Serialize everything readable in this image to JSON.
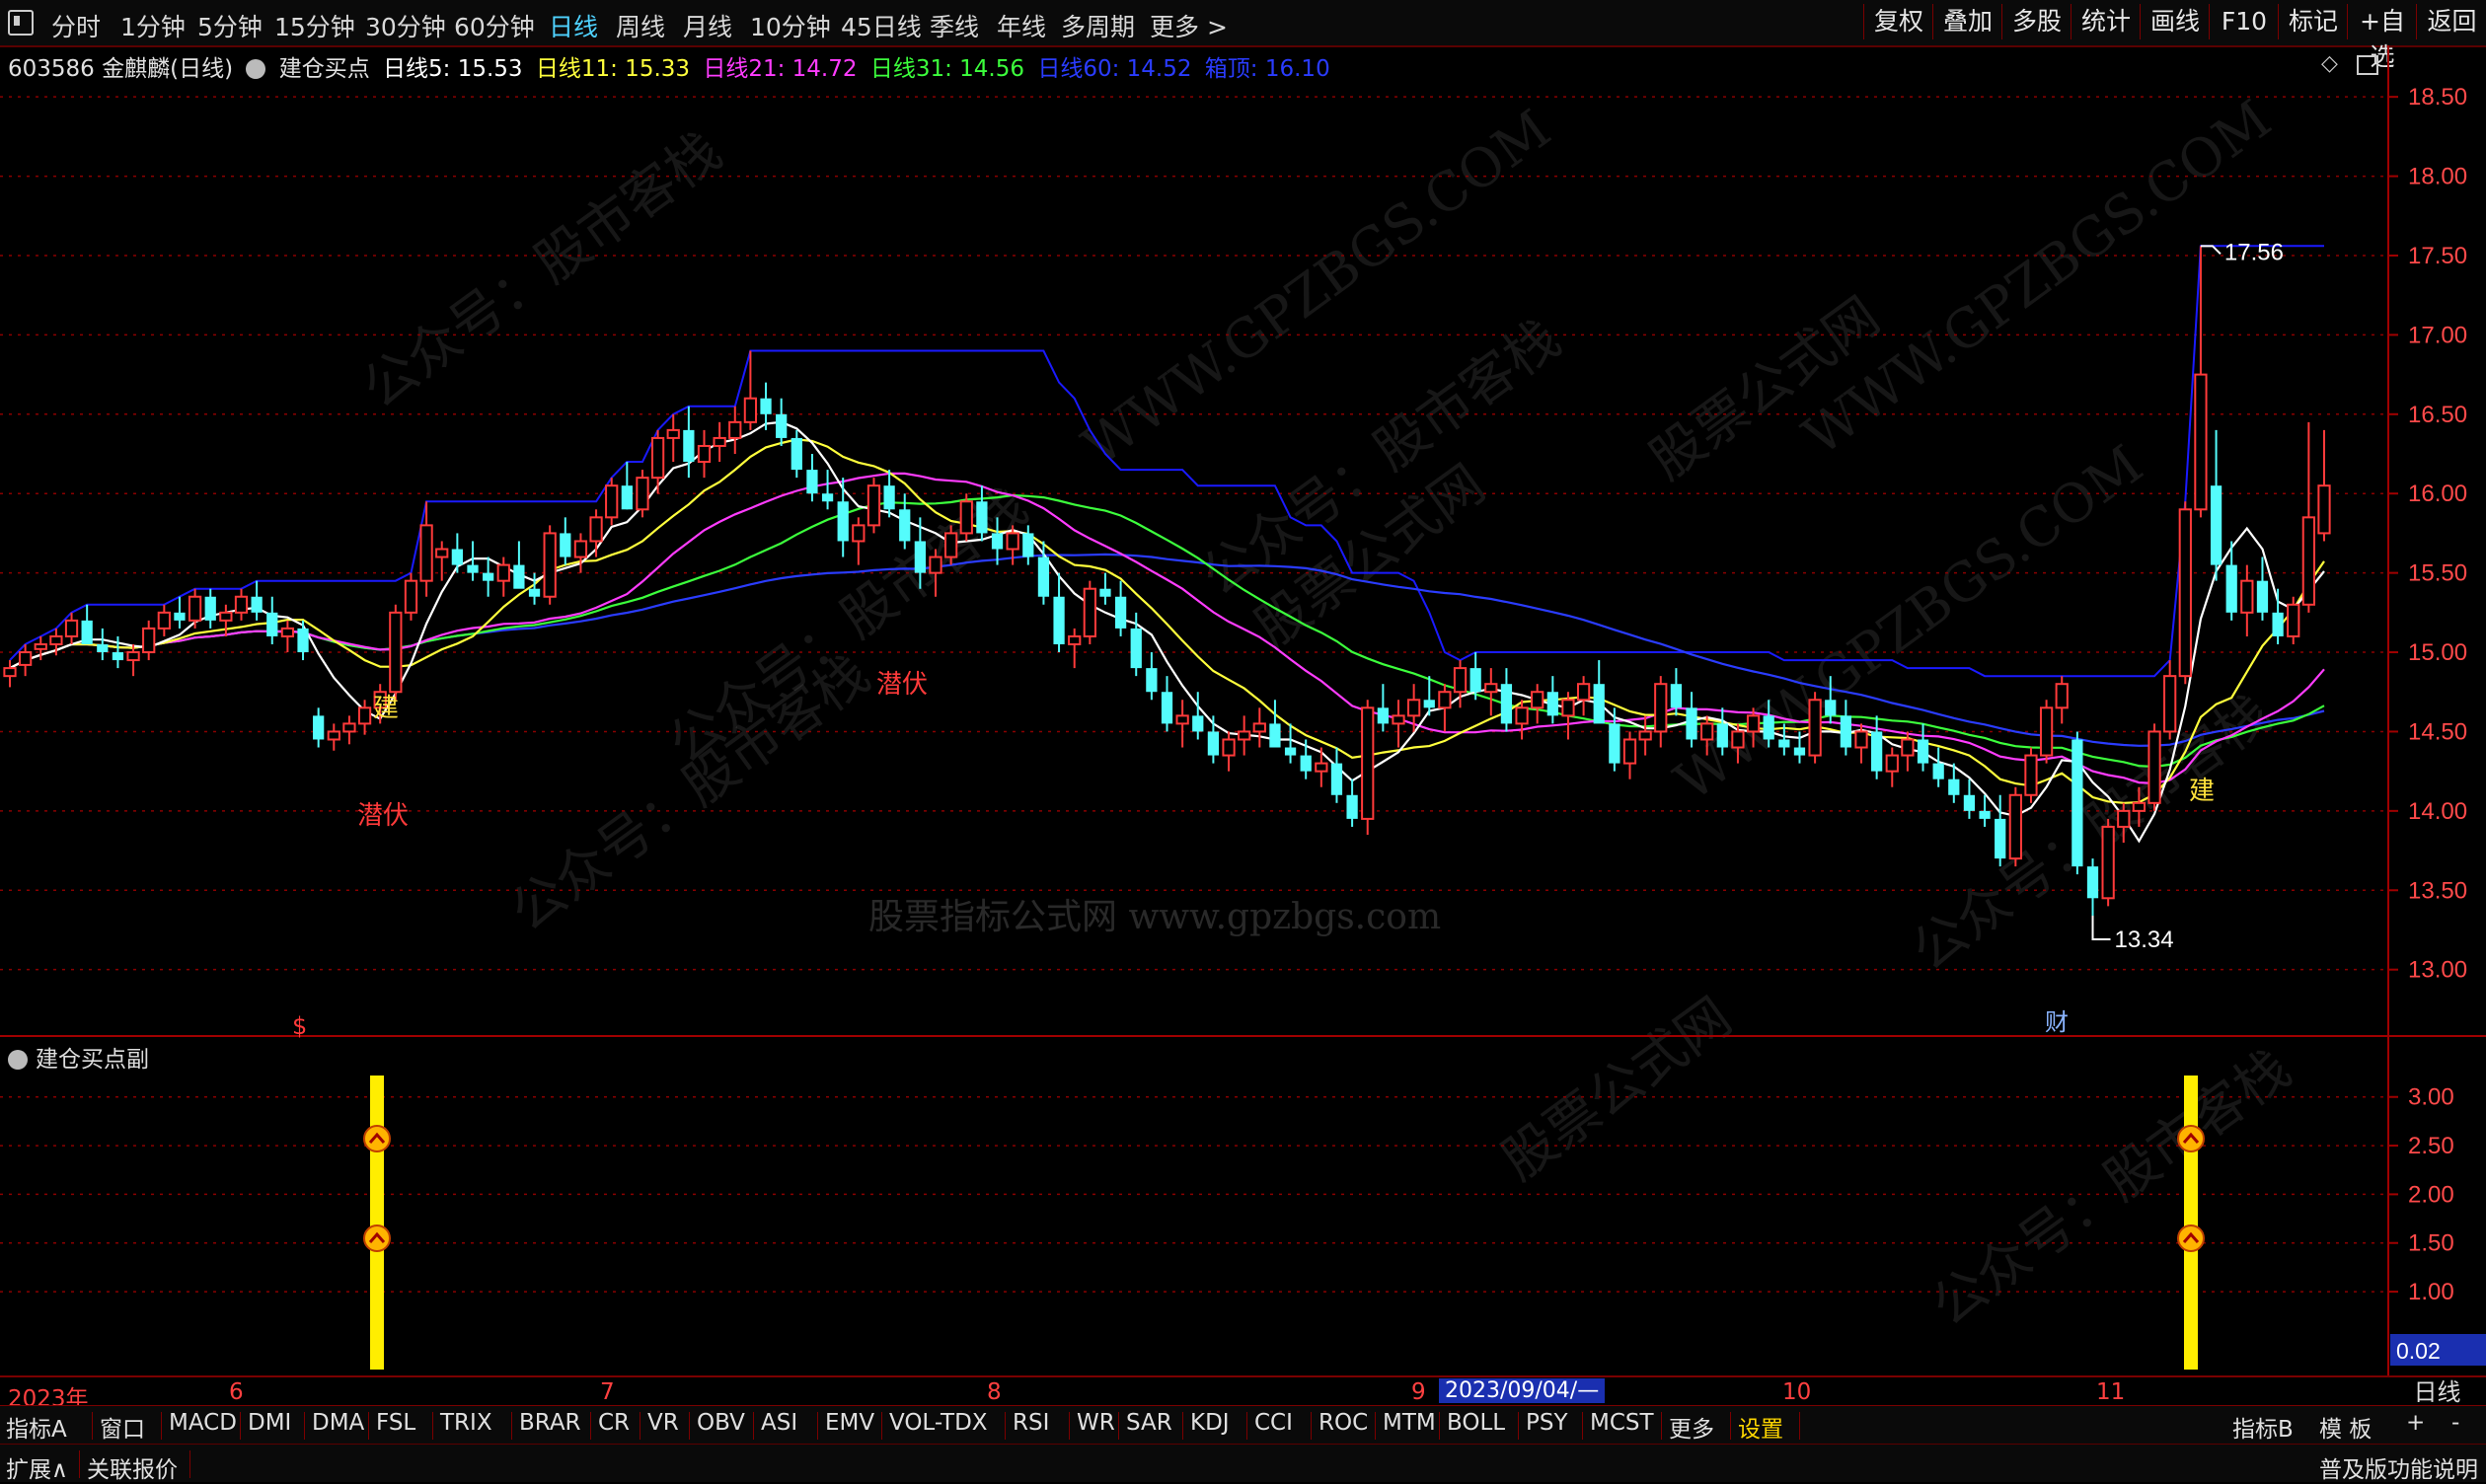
{
  "topbar": {
    "periods": [
      "分时",
      "1分钟",
      "5分钟",
      "15分钟",
      "30分钟",
      "60分钟",
      "日线",
      "周线",
      "月线",
      "10分钟",
      "45日线",
      "季线",
      "年线",
      "多周期",
      "更多 >"
    ],
    "active_period": "日线",
    "right_buttons": [
      "复权",
      "叠加",
      "多股",
      "统计",
      "画线",
      "F10",
      "标记",
      "+自选",
      "返回"
    ]
  },
  "legend": {
    "stock": "603586 金麒麟(日线)",
    "indicator": "建仓买点",
    "ma5": "日线5: 15.53",
    "ma11": "日线11: 15.33",
    "ma21": "日线21: 14.72",
    "ma31": "日线31: 14.56",
    "ma60": "日线60: 14.52",
    "box": "箱顶: 16.10"
  },
  "colors": {
    "up": "#ff3a3a",
    "down": "#54fcfc",
    "ma5": "#ffffff",
    "ma11": "#ffff3c",
    "ma21": "#ff3cff",
    "ma31": "#3cff3c",
    "ma60": "#2a3cff",
    "box": "#1a1aff",
    "grid": "#8a0000"
  },
  "price_axis": [
    "18.50",
    "18.00",
    "17.50",
    "17.00",
    "16.50",
    "16.00",
    "15.50",
    "15.00",
    "14.50",
    "14.00",
    "13.50",
    "13.00"
  ],
  "annotations": {
    "high": "17.56",
    "low": "13.34",
    "build1": "建",
    "build2": "建",
    "hide1": "潜伏",
    "hide2": "潜伏",
    "dollar": "$",
    "cai": "财"
  },
  "watermarks": [
    "公众号：股市客栈",
    "WWW.GPZBGS.COM",
    "股票公式网",
    "股票指标公式网 www.gpzbgs.com"
  ],
  "indicator_panel": {
    "title": "建仓买点副",
    "axis": [
      "3.00",
      "2.50",
      "2.00",
      "1.50",
      "1.00"
    ],
    "value_box": "0.02"
  },
  "chart_data": {
    "type": "candlestick",
    "series_names": [
      "日线5",
      "日线11",
      "日线21",
      "日线31",
      "日线60",
      "箱顶"
    ],
    "ylim": [
      12.6,
      18.7
    ],
    "x_months": [
      "2023年",
      "6",
      "7",
      "8",
      "9",
      "10",
      "11"
    ],
    "selected_date": "2023/09/04/—",
    "candles": [
      [
        14.85,
        14.95,
        14.78,
        14.9
      ],
      [
        14.92,
        15.05,
        14.85,
        15.0
      ],
      [
        15.02,
        15.1,
        14.95,
        15.05
      ],
      [
        15.05,
        15.15,
        14.98,
        15.1
      ],
      [
        15.1,
        15.25,
        15.05,
        15.2
      ],
      [
        15.2,
        15.3,
        15.1,
        15.05
      ],
      [
        15.05,
        15.15,
        14.95,
        15.0
      ],
      [
        15.0,
        15.1,
        14.9,
        14.95
      ],
      [
        14.95,
        15.05,
        14.85,
        15.0
      ],
      [
        15.0,
        15.2,
        14.95,
        15.15
      ],
      [
        15.15,
        15.3,
        15.1,
        15.25
      ],
      [
        15.25,
        15.35,
        15.15,
        15.2
      ],
      [
        15.2,
        15.4,
        15.15,
        15.35
      ],
      [
        15.35,
        15.4,
        15.15,
        15.2
      ],
      [
        15.2,
        15.3,
        15.1,
        15.25
      ],
      [
        15.25,
        15.4,
        15.2,
        15.35
      ],
      [
        15.35,
        15.45,
        15.2,
        15.25
      ],
      [
        15.25,
        15.35,
        15.05,
        15.1
      ],
      [
        15.1,
        15.2,
        15.0,
        15.15
      ],
      [
        15.15,
        15.2,
        14.95,
        15.0
      ],
      [
        14.6,
        14.65,
        14.4,
        14.45
      ],
      [
        14.45,
        14.55,
        14.38,
        14.5
      ],
      [
        14.5,
        14.6,
        14.42,
        14.55
      ],
      [
        14.55,
        14.7,
        14.48,
        14.65
      ],
      [
        14.65,
        14.8,
        14.55,
        14.75
      ],
      [
        14.75,
        15.3,
        14.7,
        15.25
      ],
      [
        15.25,
        15.5,
        15.2,
        15.45
      ],
      [
        15.45,
        15.95,
        15.35,
        15.8
      ],
      [
        15.6,
        15.7,
        15.45,
        15.65
      ],
      [
        15.65,
        15.75,
        15.5,
        15.55
      ],
      [
        15.55,
        15.7,
        15.45,
        15.5
      ],
      [
        15.5,
        15.6,
        15.35,
        15.45
      ],
      [
        15.45,
        15.6,
        15.35,
        15.55
      ],
      [
        15.55,
        15.7,
        15.45,
        15.4
      ],
      [
        15.4,
        15.5,
        15.3,
        15.35
      ],
      [
        15.35,
        15.8,
        15.3,
        15.75
      ],
      [
        15.75,
        15.85,
        15.55,
        15.6
      ],
      [
        15.6,
        15.75,
        15.5,
        15.7
      ],
      [
        15.7,
        15.9,
        15.6,
        15.85
      ],
      [
        15.85,
        16.1,
        15.8,
        16.05
      ],
      [
        16.05,
        16.2,
        15.9,
        15.9
      ],
      [
        15.9,
        16.15,
        15.85,
        16.1
      ],
      [
        16.1,
        16.4,
        16.0,
        16.35
      ],
      [
        16.35,
        16.5,
        16.2,
        16.4
      ],
      [
        16.4,
        16.55,
        16.1,
        16.2
      ],
      [
        16.2,
        16.4,
        16.1,
        16.3
      ],
      [
        16.3,
        16.45,
        16.2,
        16.35
      ],
      [
        16.35,
        16.55,
        16.25,
        16.45
      ],
      [
        16.45,
        16.9,
        16.4,
        16.6
      ],
      [
        16.6,
        16.7,
        16.4,
        16.5
      ],
      [
        16.5,
        16.6,
        16.3,
        16.35
      ],
      [
        16.35,
        16.4,
        16.1,
        16.15
      ],
      [
        16.15,
        16.25,
        15.95,
        16.0
      ],
      [
        16.0,
        16.15,
        15.9,
        15.95
      ],
      [
        15.95,
        16.1,
        15.6,
        15.7
      ],
      [
        15.7,
        15.85,
        15.55,
        15.8
      ],
      [
        15.8,
        16.1,
        15.75,
        16.05
      ],
      [
        16.05,
        16.15,
        15.85,
        15.9
      ],
      [
        15.9,
        16.0,
        15.65,
        15.7
      ],
      [
        15.7,
        15.85,
        15.4,
        15.5
      ],
      [
        15.5,
        15.65,
        15.35,
        15.6
      ],
      [
        15.6,
        15.8,
        15.55,
        15.75
      ],
      [
        15.75,
        16.0,
        15.7,
        15.95
      ],
      [
        15.95,
        16.05,
        15.7,
        15.75
      ],
      [
        15.75,
        15.85,
        15.55,
        15.65
      ],
      [
        15.65,
        15.8,
        15.55,
        15.75
      ],
      [
        15.75,
        15.8,
        15.55,
        15.6
      ],
      [
        15.6,
        15.7,
        15.3,
        15.35
      ],
      [
        15.35,
        15.5,
        15.0,
        15.05
      ],
      [
        15.05,
        15.15,
        14.9,
        15.1
      ],
      [
        15.1,
        15.45,
        15.05,
        15.4
      ],
      [
        15.4,
        15.5,
        15.3,
        15.35
      ],
      [
        15.35,
        15.45,
        15.1,
        15.15
      ],
      [
        15.15,
        15.25,
        14.85,
        14.9
      ],
      [
        14.9,
        15.0,
        14.7,
        14.75
      ],
      [
        14.75,
        14.85,
        14.5,
        14.55
      ],
      [
        14.55,
        14.7,
        14.4,
        14.6
      ],
      [
        14.6,
        14.75,
        14.45,
        14.5
      ],
      [
        14.5,
        14.6,
        14.3,
        14.35
      ],
      [
        14.35,
        14.5,
        14.25,
        14.45
      ],
      [
        14.45,
        14.6,
        14.35,
        14.5
      ],
      [
        14.5,
        14.65,
        14.4,
        14.55
      ],
      [
        14.55,
        14.7,
        14.45,
        14.4
      ],
      [
        14.4,
        14.55,
        14.3,
        14.35
      ],
      [
        14.35,
        14.45,
        14.2,
        14.25
      ],
      [
        14.25,
        14.4,
        14.15,
        14.3
      ],
      [
        14.3,
        14.4,
        14.05,
        14.1
      ],
      [
        14.1,
        14.2,
        13.9,
        13.95
      ],
      [
        13.95,
        14.7,
        13.85,
        14.65
      ],
      [
        14.65,
        14.8,
        14.5,
        14.55
      ],
      [
        14.55,
        14.7,
        14.4,
        14.6
      ],
      [
        14.6,
        14.8,
        14.5,
        14.7
      ],
      [
        14.7,
        14.85,
        14.6,
        14.65
      ],
      [
        14.65,
        14.8,
        14.5,
        14.75
      ],
      [
        14.75,
        14.95,
        14.65,
        14.9
      ],
      [
        14.9,
        15.0,
        14.7,
        14.75
      ],
      [
        14.75,
        14.9,
        14.6,
        14.8
      ],
      [
        14.8,
        14.9,
        14.5,
        14.55
      ],
      [
        14.55,
        14.7,
        14.45,
        14.65
      ],
      [
        14.65,
        14.8,
        14.55,
        14.75
      ],
      [
        14.75,
        14.85,
        14.55,
        14.6
      ],
      [
        14.6,
        14.75,
        14.45,
        14.7
      ],
      [
        14.7,
        14.85,
        14.6,
        14.8
      ],
      [
        14.8,
        14.95,
        14.7,
        14.55
      ],
      [
        14.55,
        14.65,
        14.25,
        14.3
      ],
      [
        14.3,
        14.5,
        14.2,
        14.45
      ],
      [
        14.45,
        14.6,
        14.35,
        14.5
      ],
      [
        14.5,
        14.85,
        14.4,
        14.8
      ],
      [
        14.8,
        14.9,
        14.6,
        14.65
      ],
      [
        14.65,
        14.75,
        14.4,
        14.45
      ],
      [
        14.45,
        14.6,
        14.35,
        14.55
      ],
      [
        14.55,
        14.65,
        14.35,
        14.4
      ],
      [
        14.4,
        14.55,
        14.3,
        14.5
      ],
      [
        14.5,
        14.65,
        14.4,
        14.6
      ],
      [
        14.6,
        14.7,
        14.4,
        14.45
      ],
      [
        14.45,
        14.55,
        14.35,
        14.4
      ],
      [
        14.4,
        14.5,
        14.3,
        14.35
      ],
      [
        14.35,
        14.75,
        14.3,
        14.7
      ],
      [
        14.7,
        14.85,
        14.55,
        14.6
      ],
      [
        14.6,
        14.7,
        14.35,
        14.4
      ],
      [
        14.4,
        14.55,
        14.3,
        14.5
      ],
      [
        14.5,
        14.6,
        14.2,
        14.25
      ],
      [
        14.25,
        14.4,
        14.15,
        14.35
      ],
      [
        14.35,
        14.5,
        14.25,
        14.45
      ],
      [
        14.45,
        14.55,
        14.25,
        14.3
      ],
      [
        14.3,
        14.4,
        14.15,
        14.2
      ],
      [
        14.2,
        14.3,
        14.05,
        14.1
      ],
      [
        14.1,
        14.2,
        13.95,
        14.0
      ],
      [
        14.0,
        14.1,
        13.9,
        13.95
      ],
      [
        13.95,
        14.1,
        13.65,
        13.7
      ],
      [
        13.7,
        14.15,
        13.65,
        14.1
      ],
      [
        14.1,
        14.4,
        14.05,
        14.35
      ],
      [
        14.35,
        14.7,
        14.3,
        14.65
      ],
      [
        14.65,
        14.85,
        14.55,
        14.8
      ],
      [
        14.45,
        14.5,
        13.6,
        13.65
      ],
      [
        13.65,
        13.7,
        13.34,
        13.45
      ],
      [
        13.45,
        13.95,
        13.4,
        13.9
      ],
      [
        13.9,
        14.05,
        13.8,
        14.0
      ],
      [
        14.0,
        14.15,
        13.9,
        14.05
      ],
      [
        14.05,
        14.55,
        14.0,
        14.5
      ],
      [
        14.5,
        14.95,
        14.45,
        14.85
      ],
      [
        14.85,
        15.95,
        14.8,
        15.9
      ],
      [
        15.9,
        17.56,
        15.85,
        16.75
      ],
      [
        16.05,
        16.4,
        15.45,
        15.55
      ],
      [
        15.55,
        15.7,
        15.2,
        15.25
      ],
      [
        15.25,
        15.55,
        15.1,
        15.45
      ],
      [
        15.45,
        15.6,
        15.2,
        15.25
      ],
      [
        15.25,
        15.4,
        15.05,
        15.1
      ],
      [
        15.1,
        15.35,
        15.05,
        15.3
      ],
      [
        15.3,
        16.45,
        15.25,
        15.85
      ],
      [
        15.75,
        16.4,
        15.7,
        16.05
      ]
    ]
  }
}
